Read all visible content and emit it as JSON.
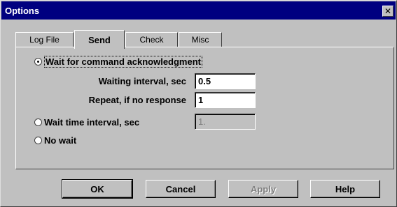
{
  "window": {
    "title": "Options",
    "close_symbol": "✕"
  },
  "tabs": [
    {
      "label": "Log File",
      "active": false
    },
    {
      "label": "Send",
      "active": true
    },
    {
      "label": "Check",
      "active": false
    },
    {
      "label": "Misc",
      "active": false
    }
  ],
  "send": {
    "wait_ack": {
      "label": "Wait for command acknowledgment",
      "selected": true
    },
    "waiting_interval": {
      "label": "Waiting interval, sec",
      "value": "0.5"
    },
    "repeat": {
      "label": "Repeat, if no response",
      "value": "1"
    },
    "wait_time": {
      "label": "Wait time interval, sec",
      "selected": false,
      "value": "1."
    },
    "no_wait": {
      "label": "No wait",
      "selected": false
    }
  },
  "buttons": {
    "ok": "OK",
    "cancel": "Cancel",
    "apply": "Apply",
    "help": "Help"
  }
}
